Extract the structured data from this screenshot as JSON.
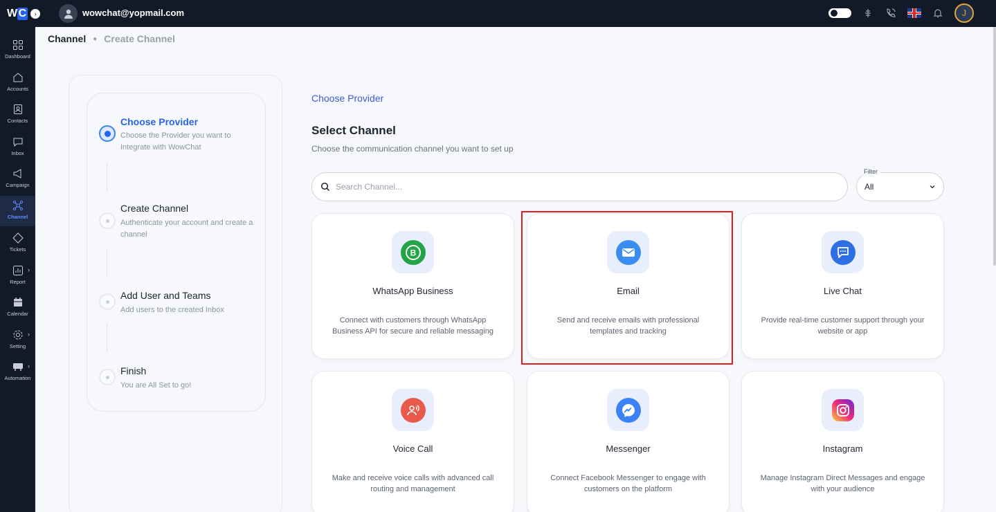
{
  "app": {
    "logo_w": "W",
    "logo_c": "C",
    "user_email": "wowchat@yopmail.com",
    "avatar_initial": "J"
  },
  "sidebar": {
    "items": [
      {
        "label": "Dashboard",
        "icon": "dashboard-icon"
      },
      {
        "label": "Accounts",
        "icon": "home-icon"
      },
      {
        "label": "Contacts",
        "icon": "contact-icon"
      },
      {
        "label": "Inbox",
        "icon": "inbox-icon"
      },
      {
        "label": "Campaign",
        "icon": "megaphone-icon"
      },
      {
        "label": "Channel",
        "icon": "channel-icon",
        "active": true
      },
      {
        "label": "Tickets",
        "icon": "ticket-icon"
      },
      {
        "label": "Report",
        "icon": "report-icon"
      },
      {
        "label": "Calendar",
        "icon": "calendar-icon"
      },
      {
        "label": "Setting",
        "icon": "gear-icon"
      },
      {
        "label": "Automation",
        "icon": "automation-icon"
      }
    ]
  },
  "breadcrumb": {
    "root": "Channel",
    "current": "Create Channel"
  },
  "steps": [
    {
      "title": "Choose Provider",
      "desc": "Choose the Provider you want to Integrate with WowChat",
      "active": true
    },
    {
      "title": "Create Channel",
      "desc": "Authenticate your account and create a channel",
      "active": false
    },
    {
      "title": "Add User and Teams",
      "desc": "Add users to the created Inbox",
      "active": false
    },
    {
      "title": "Finish",
      "desc": "You are All Set to go!",
      "active": false
    }
  ],
  "panel": {
    "choose_label": "Choose Provider",
    "title": "Select Channel",
    "subtitle": "Choose the communication channel you want to set up",
    "search_placeholder": "Search Channel...",
    "filter_label": "Filter",
    "filter_value": "All"
  },
  "channels": [
    {
      "name": "WhatsApp Business",
      "desc": "Connect with customers through WhatsApp Business API for secure and reliable messaging",
      "icon": "whatsapp-business-icon",
      "color": "#22a447"
    },
    {
      "name": "Email",
      "desc": "Send and receive emails with professional templates and tracking",
      "icon": "email-icon",
      "color": "#3b8ef0"
    },
    {
      "name": "Live Chat",
      "desc": "Provide real-time customer support through your website or app",
      "icon": "chat-icon",
      "color": "#2f6fe4"
    },
    {
      "name": "Voice Call",
      "desc": "Make and receive voice calls with advanced call routing and management",
      "icon": "voice-call-icon",
      "color": "#ea5a4a"
    },
    {
      "name": "Messenger",
      "desc": "Connect Facebook Messenger to engage with customers on the platform",
      "icon": "messenger-icon",
      "color": "#3b82f6"
    },
    {
      "name": "Instagram",
      "desc": "Manage Instagram Direct Messages and engage with your audience",
      "icon": "instagram-icon",
      "color": "#d62976"
    }
  ]
}
